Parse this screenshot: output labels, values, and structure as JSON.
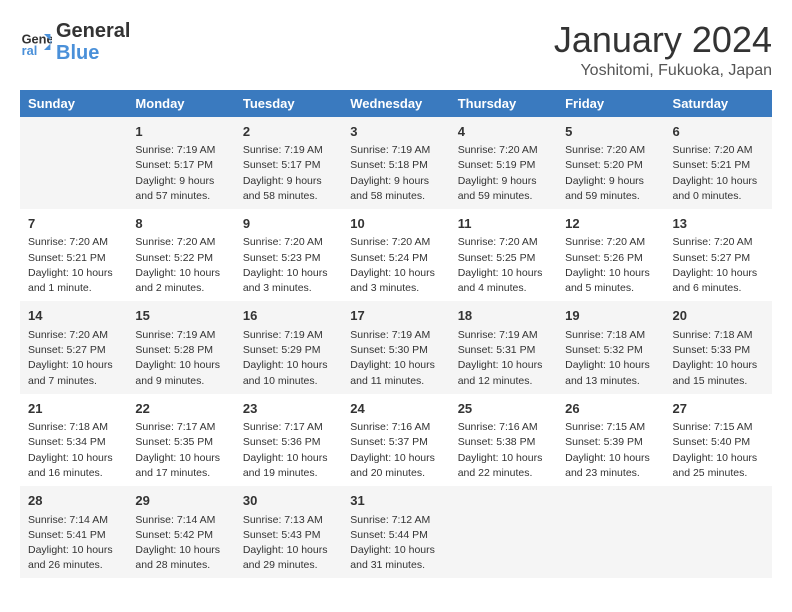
{
  "logo": {
    "line1": "General",
    "line2": "Blue"
  },
  "title": "January 2024",
  "location": "Yoshitomi, Fukuoka, Japan",
  "headers": [
    "Sunday",
    "Monday",
    "Tuesday",
    "Wednesday",
    "Thursday",
    "Friday",
    "Saturday"
  ],
  "weeks": [
    [
      {
        "day": "",
        "info": ""
      },
      {
        "day": "1",
        "info": "Sunrise: 7:19 AM\nSunset: 5:17 PM\nDaylight: 9 hours\nand 57 minutes."
      },
      {
        "day": "2",
        "info": "Sunrise: 7:19 AM\nSunset: 5:17 PM\nDaylight: 9 hours\nand 58 minutes."
      },
      {
        "day": "3",
        "info": "Sunrise: 7:19 AM\nSunset: 5:18 PM\nDaylight: 9 hours\nand 58 minutes."
      },
      {
        "day": "4",
        "info": "Sunrise: 7:20 AM\nSunset: 5:19 PM\nDaylight: 9 hours\nand 59 minutes."
      },
      {
        "day": "5",
        "info": "Sunrise: 7:20 AM\nSunset: 5:20 PM\nDaylight: 9 hours\nand 59 minutes."
      },
      {
        "day": "6",
        "info": "Sunrise: 7:20 AM\nSunset: 5:21 PM\nDaylight: 10 hours\nand 0 minutes."
      }
    ],
    [
      {
        "day": "7",
        "info": "Sunrise: 7:20 AM\nSunset: 5:21 PM\nDaylight: 10 hours\nand 1 minute."
      },
      {
        "day": "8",
        "info": "Sunrise: 7:20 AM\nSunset: 5:22 PM\nDaylight: 10 hours\nand 2 minutes."
      },
      {
        "day": "9",
        "info": "Sunrise: 7:20 AM\nSunset: 5:23 PM\nDaylight: 10 hours\nand 3 minutes."
      },
      {
        "day": "10",
        "info": "Sunrise: 7:20 AM\nSunset: 5:24 PM\nDaylight: 10 hours\nand 3 minutes."
      },
      {
        "day": "11",
        "info": "Sunrise: 7:20 AM\nSunset: 5:25 PM\nDaylight: 10 hours\nand 4 minutes."
      },
      {
        "day": "12",
        "info": "Sunrise: 7:20 AM\nSunset: 5:26 PM\nDaylight: 10 hours\nand 5 minutes."
      },
      {
        "day": "13",
        "info": "Sunrise: 7:20 AM\nSunset: 5:27 PM\nDaylight: 10 hours\nand 6 minutes."
      }
    ],
    [
      {
        "day": "14",
        "info": "Sunrise: 7:20 AM\nSunset: 5:27 PM\nDaylight: 10 hours\nand 7 minutes."
      },
      {
        "day": "15",
        "info": "Sunrise: 7:19 AM\nSunset: 5:28 PM\nDaylight: 10 hours\nand 9 minutes."
      },
      {
        "day": "16",
        "info": "Sunrise: 7:19 AM\nSunset: 5:29 PM\nDaylight: 10 hours\nand 10 minutes."
      },
      {
        "day": "17",
        "info": "Sunrise: 7:19 AM\nSunset: 5:30 PM\nDaylight: 10 hours\nand 11 minutes."
      },
      {
        "day": "18",
        "info": "Sunrise: 7:19 AM\nSunset: 5:31 PM\nDaylight: 10 hours\nand 12 minutes."
      },
      {
        "day": "19",
        "info": "Sunrise: 7:18 AM\nSunset: 5:32 PM\nDaylight: 10 hours\nand 13 minutes."
      },
      {
        "day": "20",
        "info": "Sunrise: 7:18 AM\nSunset: 5:33 PM\nDaylight: 10 hours\nand 15 minutes."
      }
    ],
    [
      {
        "day": "21",
        "info": "Sunrise: 7:18 AM\nSunset: 5:34 PM\nDaylight: 10 hours\nand 16 minutes."
      },
      {
        "day": "22",
        "info": "Sunrise: 7:17 AM\nSunset: 5:35 PM\nDaylight: 10 hours\nand 17 minutes."
      },
      {
        "day": "23",
        "info": "Sunrise: 7:17 AM\nSunset: 5:36 PM\nDaylight: 10 hours\nand 19 minutes."
      },
      {
        "day": "24",
        "info": "Sunrise: 7:16 AM\nSunset: 5:37 PM\nDaylight: 10 hours\nand 20 minutes."
      },
      {
        "day": "25",
        "info": "Sunrise: 7:16 AM\nSunset: 5:38 PM\nDaylight: 10 hours\nand 22 minutes."
      },
      {
        "day": "26",
        "info": "Sunrise: 7:15 AM\nSunset: 5:39 PM\nDaylight: 10 hours\nand 23 minutes."
      },
      {
        "day": "27",
        "info": "Sunrise: 7:15 AM\nSunset: 5:40 PM\nDaylight: 10 hours\nand 25 minutes."
      }
    ],
    [
      {
        "day": "28",
        "info": "Sunrise: 7:14 AM\nSunset: 5:41 PM\nDaylight: 10 hours\nand 26 minutes."
      },
      {
        "day": "29",
        "info": "Sunrise: 7:14 AM\nSunset: 5:42 PM\nDaylight: 10 hours\nand 28 minutes."
      },
      {
        "day": "30",
        "info": "Sunrise: 7:13 AM\nSunset: 5:43 PM\nDaylight: 10 hours\nand 29 minutes."
      },
      {
        "day": "31",
        "info": "Sunrise: 7:12 AM\nSunset: 5:44 PM\nDaylight: 10 hours\nand 31 minutes."
      },
      {
        "day": "",
        "info": ""
      },
      {
        "day": "",
        "info": ""
      },
      {
        "day": "",
        "info": ""
      }
    ]
  ]
}
